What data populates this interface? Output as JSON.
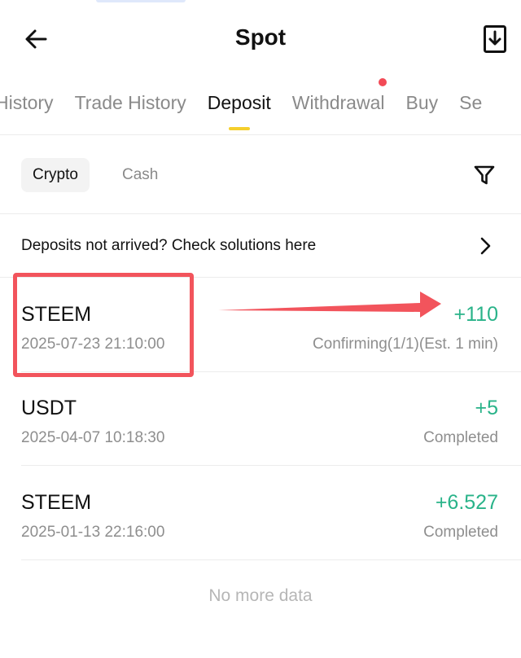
{
  "header": {
    "title": "Spot",
    "back_icon": "arrow-left-icon",
    "export_icon": "download-file-icon"
  },
  "tabs": [
    {
      "label": "History",
      "active": false,
      "dot": false
    },
    {
      "label": "Trade History",
      "active": false,
      "dot": false
    },
    {
      "label": "Deposit",
      "active": true,
      "dot": false
    },
    {
      "label": "Withdrawal",
      "active": false,
      "dot": true
    },
    {
      "label": "Buy",
      "active": false,
      "dot": false
    },
    {
      "label": "Se",
      "active": false,
      "dot": false
    }
  ],
  "subtabs": {
    "crypto": "Crypto",
    "cash": "Cash",
    "filter_icon": "funnel-filter-icon"
  },
  "notice": {
    "text": "Deposits not arrived? Check solutions here",
    "chevron_icon": "chevron-right-icon"
  },
  "records": [
    {
      "coin": "STEEM",
      "time": "2025-07-23 21:10:00",
      "amount": "+110",
      "status": "Confirming(1/1)(Est. 1 min)"
    },
    {
      "coin": "USDT",
      "time": "2025-04-07 10:18:30",
      "amount": "+5",
      "status": "Completed"
    },
    {
      "coin": "STEEM",
      "time": "2025-01-13 22:16:00",
      "amount": "+6.527",
      "status": "Completed"
    }
  ],
  "footer": {
    "no_more": "No more data"
  },
  "colors": {
    "accent": "#f5cf2c",
    "positive": "#29b389",
    "annotation": "#f2545c",
    "dot": "#f24a56"
  }
}
